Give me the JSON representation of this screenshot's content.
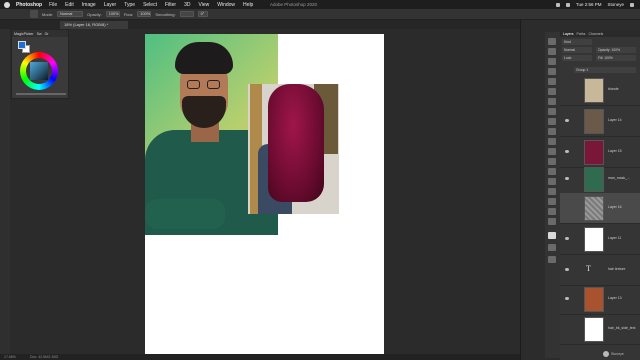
{
  "menubar": {
    "app": "Photoshop",
    "items": [
      "File",
      "Edit",
      "Image",
      "Layer",
      "Type",
      "Select",
      "Filter",
      "3D",
      "View",
      "Window",
      "Help"
    ],
    "title": "Adobe Photoshop 2020",
    "clock": "Tue 2:56 PM",
    "user": "Stoneye"
  },
  "options": {
    "mode_label": "Mode:",
    "mode_value": "Normal",
    "opacity_label": "Opacity:",
    "opacity_value": "100%",
    "flow_label": "Flow:",
    "flow_value": "100%",
    "smoothing_label": "Smoothing:",
    "angle_value": "0°"
  },
  "document": {
    "tab_title": "18% (Layer 16, RGB/8) *"
  },
  "color_panel": {
    "tabs": [
      "MagicPicker",
      "Sw",
      "Gr"
    ],
    "foreground": "#1a70d8",
    "background": "#ffffff"
  },
  "layers_panel": {
    "tabs": [
      "Layers",
      "Paths",
      "Channels"
    ],
    "kind_label": "Kind",
    "blend_mode": "Normal",
    "opacity_label": "Opacity:",
    "opacity_value": "100%",
    "lock_label": "Lock:",
    "fill_label": "Fill:",
    "fill_value": "100%",
    "group_name": "Group 1",
    "layers": [
      {
        "name": "blonde",
        "selected": false,
        "thumb": "#c9b79a"
      },
      {
        "name": "Layer 14",
        "selected": false,
        "thumb": "#6b5a4a"
      },
      {
        "name": "Layer 15",
        "selected": false,
        "thumb": "#7a1638"
      },
      {
        "name": "man_mask_...",
        "selected": false,
        "thumb": "#2f6b4f"
      },
      {
        "name": "Layer 16",
        "selected": true,
        "thumb": "#8a8a8a"
      },
      {
        "name": "Layer 11",
        "selected": false,
        "thumb": "#ffffff"
      },
      {
        "name": "hair texture",
        "selected": false,
        "thumb": "text"
      },
      {
        "name": "Layer 13",
        "selected": false,
        "thumb": "#a8532e"
      },
      {
        "name": "hair_bk_side_text",
        "selected": false,
        "thumb": "#ffffff"
      }
    ]
  },
  "status": {
    "zoom": "17.68%",
    "doc": "Doc: 42.6M/1.50G"
  },
  "watermark": "Stoneye"
}
